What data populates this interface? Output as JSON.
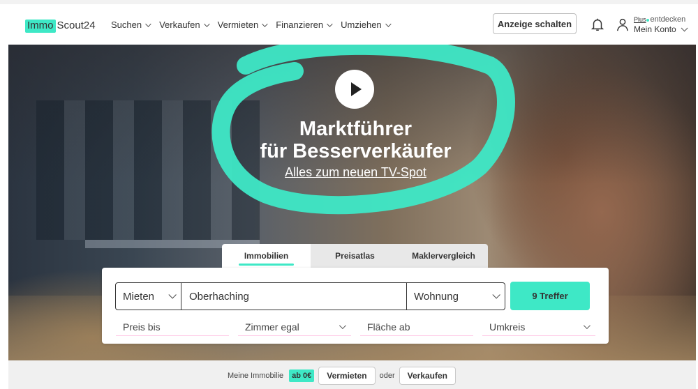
{
  "header": {
    "logo_immo": "Immo",
    "logo_scout": "Scout24",
    "nav": [
      "Suchen",
      "Verkaufen",
      "Vermieten",
      "Finanzieren",
      "Umziehen"
    ],
    "anzeige_label": "Anzeige schalten",
    "plus_label": "Plus",
    "entdecken_label": "entdecken",
    "konto_label": "Mein Konto"
  },
  "hero": {
    "title_line1": "Marktführer",
    "title_line2": "für Besserverkäufer",
    "link_label": "Alles zum neuen TV-Spot"
  },
  "tabs": [
    "Immobilien",
    "Preisatlas",
    "Maklervergleich"
  ],
  "search": {
    "mode_value": "Mieten",
    "location_value": "Oberhaching",
    "type_value": "Wohnung",
    "results_button": "9 Treffer",
    "filters": {
      "preis": "Preis bis",
      "zimmer": "Zimmer egal",
      "flaeche": "Fläche ab",
      "umkreis": "Umkreis"
    }
  },
  "bottom": {
    "text": "Meine Immobilie",
    "badge": "ab 0€",
    "vermieten": "Vermieten",
    "oder": "oder",
    "verkaufen": "Verkaufen"
  },
  "colors": {
    "accent": "#3ee8c6",
    "filter_underline": "#ffcce7"
  }
}
